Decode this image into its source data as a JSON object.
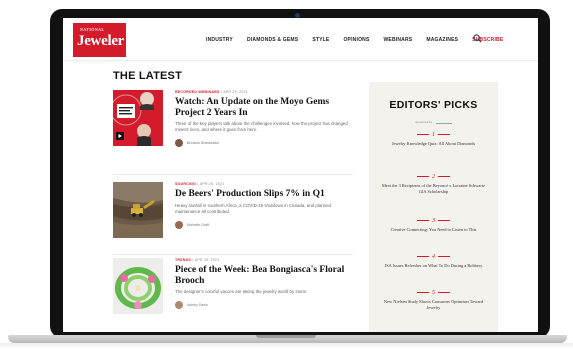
{
  "header": {
    "logo_top": "NATIONAL",
    "logo_main": "Jeweler",
    "nav": [
      "INDUSTRY",
      "DIAMONDS & GEMS",
      "STYLE",
      "OPINIONS",
      "WEBINARS",
      "MAGAZINES",
      "SUBSCRIBE"
    ]
  },
  "latest": {
    "title": "THE LATEST",
    "articles": [
      {
        "category": "RECORDED WEBINARS",
        "date": "APR 29, 2021",
        "title": "Watch: An Update on the Moyo Gems Project 2 Years In",
        "excerpt": "Three of the key players talk about the challenges involved, how the project has changed miners' lives, and where it goes from here.",
        "author": "Brecken Branstrator"
      },
      {
        "category": "SOURCING",
        "date": "APR 29, 2021",
        "title": "De Beers' Production Slips 7% in Q1",
        "excerpt": "Heavy rainfall in southern Africa, a COVID-19 shutdown in Canada, and planned maintenance all contributed.",
        "author": "Michelle Graff"
      },
      {
        "category": "TRENDS",
        "date": "APR 29, 2021",
        "title": "Piece of the Week: Bea Bongiasca's Floral Brooch",
        "excerpt": "The designer's colorful vacces are taking the jewelry world by storm.",
        "author": "Ashley Davis"
      }
    ]
  },
  "sidebar": {
    "title": "EDITORS' PICKS",
    "sponsor_label": "sponsored by",
    "picks": [
      {
        "num": "1",
        "text": "Jewelry Knowledge Quiz: All About Diamonds"
      },
      {
        "num": "2",
        "text": "Meet the 3 Recipients of the Beyoncé x Lorraine Schwartz GIA Scholarship"
      },
      {
        "num": "3",
        "text": "Creative Connecting: You Need to Listen to This"
      },
      {
        "num": "4",
        "text": "JSA Issues Refresher on What To Do During a Robbery"
      },
      {
        "num": "5",
        "text": "New Nielsen Study Shows Consumer Optimism Toward Jewelry"
      }
    ]
  },
  "colors": {
    "brand_red": "#d31b2c",
    "sidebar_bg": "#f4f2ed"
  }
}
